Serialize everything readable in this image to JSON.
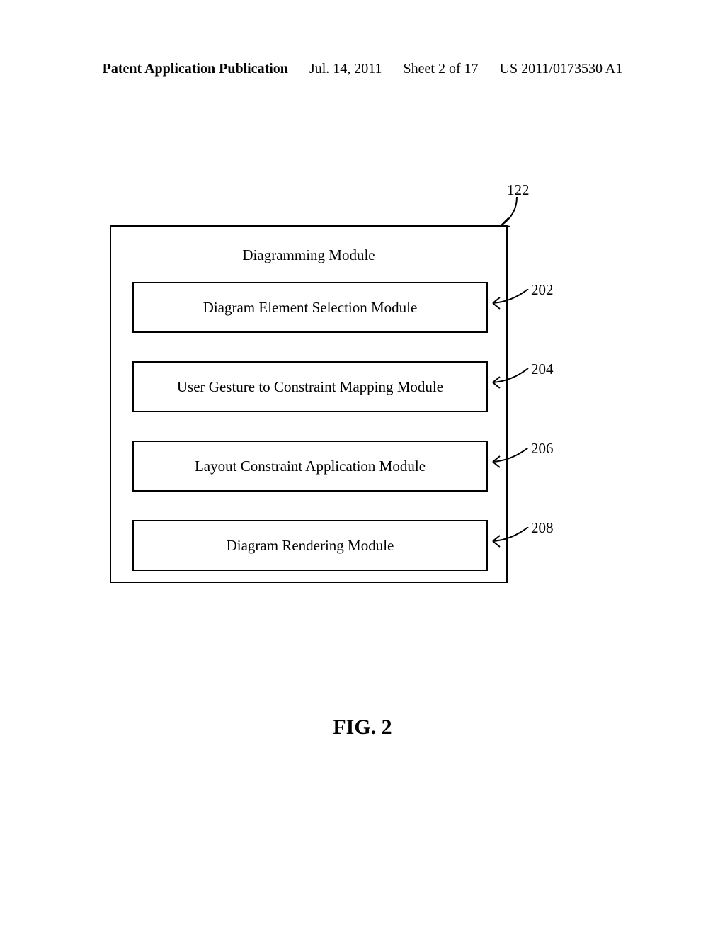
{
  "header": {
    "left": "Patent Application Publication",
    "date": "Jul. 14, 2011",
    "sheet": "Sheet 2 of 17",
    "pubnum": "US 2011/0173530 A1"
  },
  "outer": {
    "title": "Diagramming Module",
    "ref": "122"
  },
  "boxes": [
    {
      "label": "Diagram Element Selection Module",
      "ref": "202"
    },
    {
      "label": "User Gesture to Constraint Mapping Module",
      "ref": "204"
    },
    {
      "label": "Layout Constraint Application Module",
      "ref": "206"
    },
    {
      "label": "Diagram Rendering Module",
      "ref": "208"
    }
  ],
  "figure_caption": "FIG. 2"
}
